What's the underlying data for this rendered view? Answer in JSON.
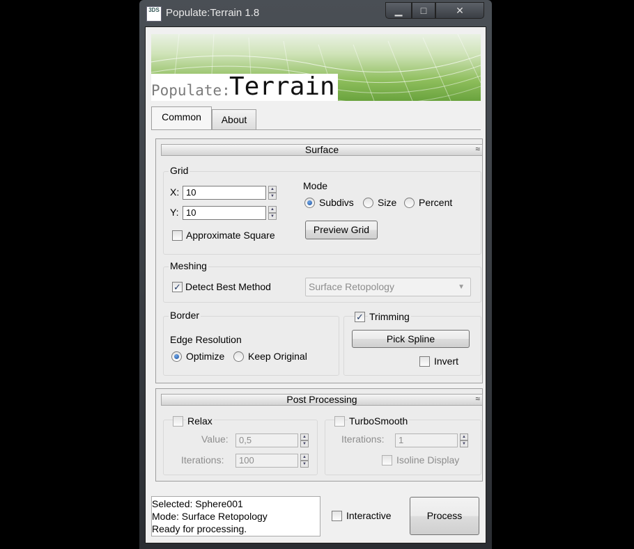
{
  "window": {
    "title": "Populate:Terrain 1.8",
    "app_icon_text": "3DS",
    "minimize_glyph": "▁",
    "maximize_glyph": "□",
    "close_glyph": "✕"
  },
  "banner": {
    "word_small": "Populate:",
    "word_big": "Terrain"
  },
  "tabs": [
    {
      "label": "Common",
      "active": true
    },
    {
      "label": "About",
      "active": false
    }
  ],
  "surface": {
    "header": "Surface",
    "collapse_glyph": "≈",
    "grid": {
      "label": "Grid",
      "x_label": "X:",
      "x_value": "10",
      "y_label": "Y:",
      "y_value": "10",
      "approx_square_label": "Approximate Square",
      "approx_square_checked": false
    },
    "mode": {
      "label": "Mode",
      "options": [
        "Subdivs",
        "Size",
        "Percent"
      ],
      "selected": "Subdivs"
    },
    "preview_grid_label": "Preview Grid",
    "meshing": {
      "label": "Meshing",
      "detect_label": "Detect Best Method",
      "detect_checked": true,
      "method_value": "Surface Retopology",
      "arrow_glyph": "▼"
    },
    "border": {
      "label": "Border",
      "edge_resolution_label": "Edge Resolution",
      "options": [
        "Optimize",
        "Keep Original"
      ],
      "selected": "Optimize"
    },
    "trimming": {
      "label": "Trimming",
      "checked": true,
      "pick_spline_label": "Pick Spline",
      "invert_label": "Invert",
      "invert_checked": false
    }
  },
  "post": {
    "header": "Post Processing",
    "collapse_glyph": "≈",
    "relax": {
      "label": "Relax",
      "checked": false,
      "value_label": "Value:",
      "value": "0,5",
      "iterations_label": "Iterations:",
      "iterations": "100"
    },
    "turbosmooth": {
      "label": "TurboSmooth",
      "checked": false,
      "iterations_label": "Iterations:",
      "iterations": "1",
      "isoline_label": "Isoline Display",
      "isoline_checked": false
    }
  },
  "status": {
    "lines": [
      "Selected: Sphere001",
      "Mode: Surface Retopology",
      "Ready for processing."
    ]
  },
  "footer": {
    "interactive_label": "Interactive",
    "interactive_checked": false,
    "process_label": "Process"
  },
  "glyphs": {
    "check": "✓",
    "spin_up": "▲",
    "spin_down": "▼"
  }
}
